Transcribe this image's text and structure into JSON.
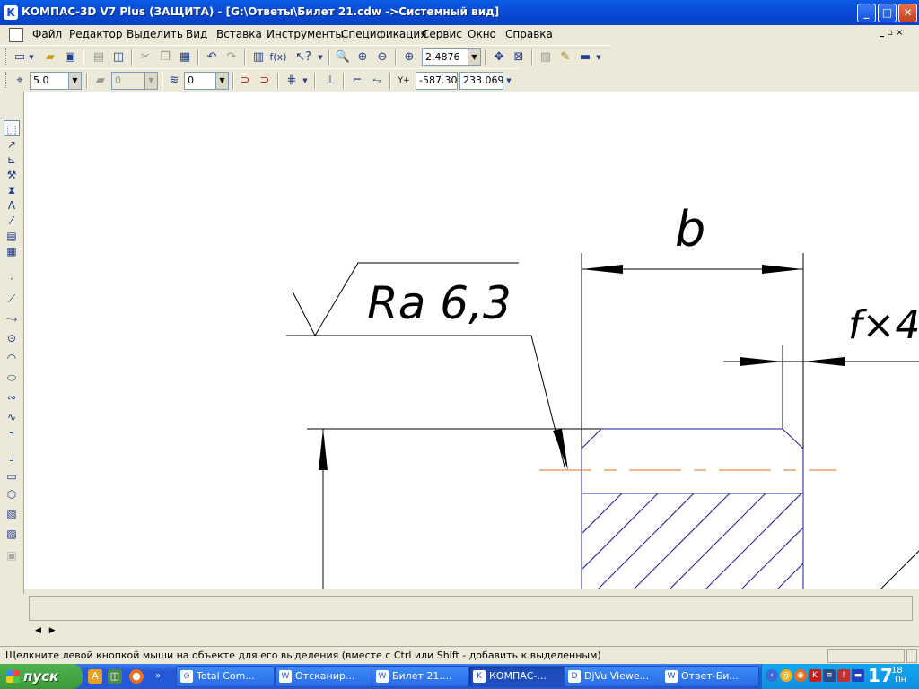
{
  "window": {
    "title": "КОМПАС-3D V7 Plus (ЗАЩИТА) - [G:\\Ответы\\Билет 21.cdw ->Системный вид]",
    "minimize": "_",
    "maximize": "□",
    "close": "✕",
    "doc_restore": "_ ▫ ×"
  },
  "menu": {
    "items": [
      "Файл",
      "Редактор",
      "Выделить",
      "Вид",
      "Вставка",
      "Инструменты",
      "Спецификация",
      "Сервис",
      "Окно",
      "Справка"
    ]
  },
  "toolbar1": {
    "zoom_value": "2.4876",
    "fx_label": "f(x)"
  },
  "toolbar2": {
    "step_value": "5.0",
    "layer_value": "0",
    "style_value": "0",
    "x_value": "-587.30",
    "y_value": "233.069",
    "coord_label": "Y+"
  },
  "drawing": {
    "dim_b": "b",
    "roughness": "Ra 6,3",
    "chamfer": "f×4."
  },
  "statusbar": {
    "message": "Щелкните левой кнопкой мыши на объекте для его выделения (вместе с Ctrl или Shift - добавить к выделенным)"
  },
  "bottom_nav": {
    "left": "◀",
    "right": "▶"
  },
  "taskbar": {
    "start_label": "пуск",
    "tasks": [
      {
        "label": "Total Com..."
      },
      {
        "label": "Отсканир..."
      },
      {
        "label": "Билет 21...."
      },
      {
        "label": "КОМПАС-..."
      },
      {
        "label": "DjVu Viewe..."
      },
      {
        "label": "Ответ-Би..."
      }
    ],
    "clock_hour": "17",
    "clock_min": "18",
    "clock_day": "Пн"
  }
}
